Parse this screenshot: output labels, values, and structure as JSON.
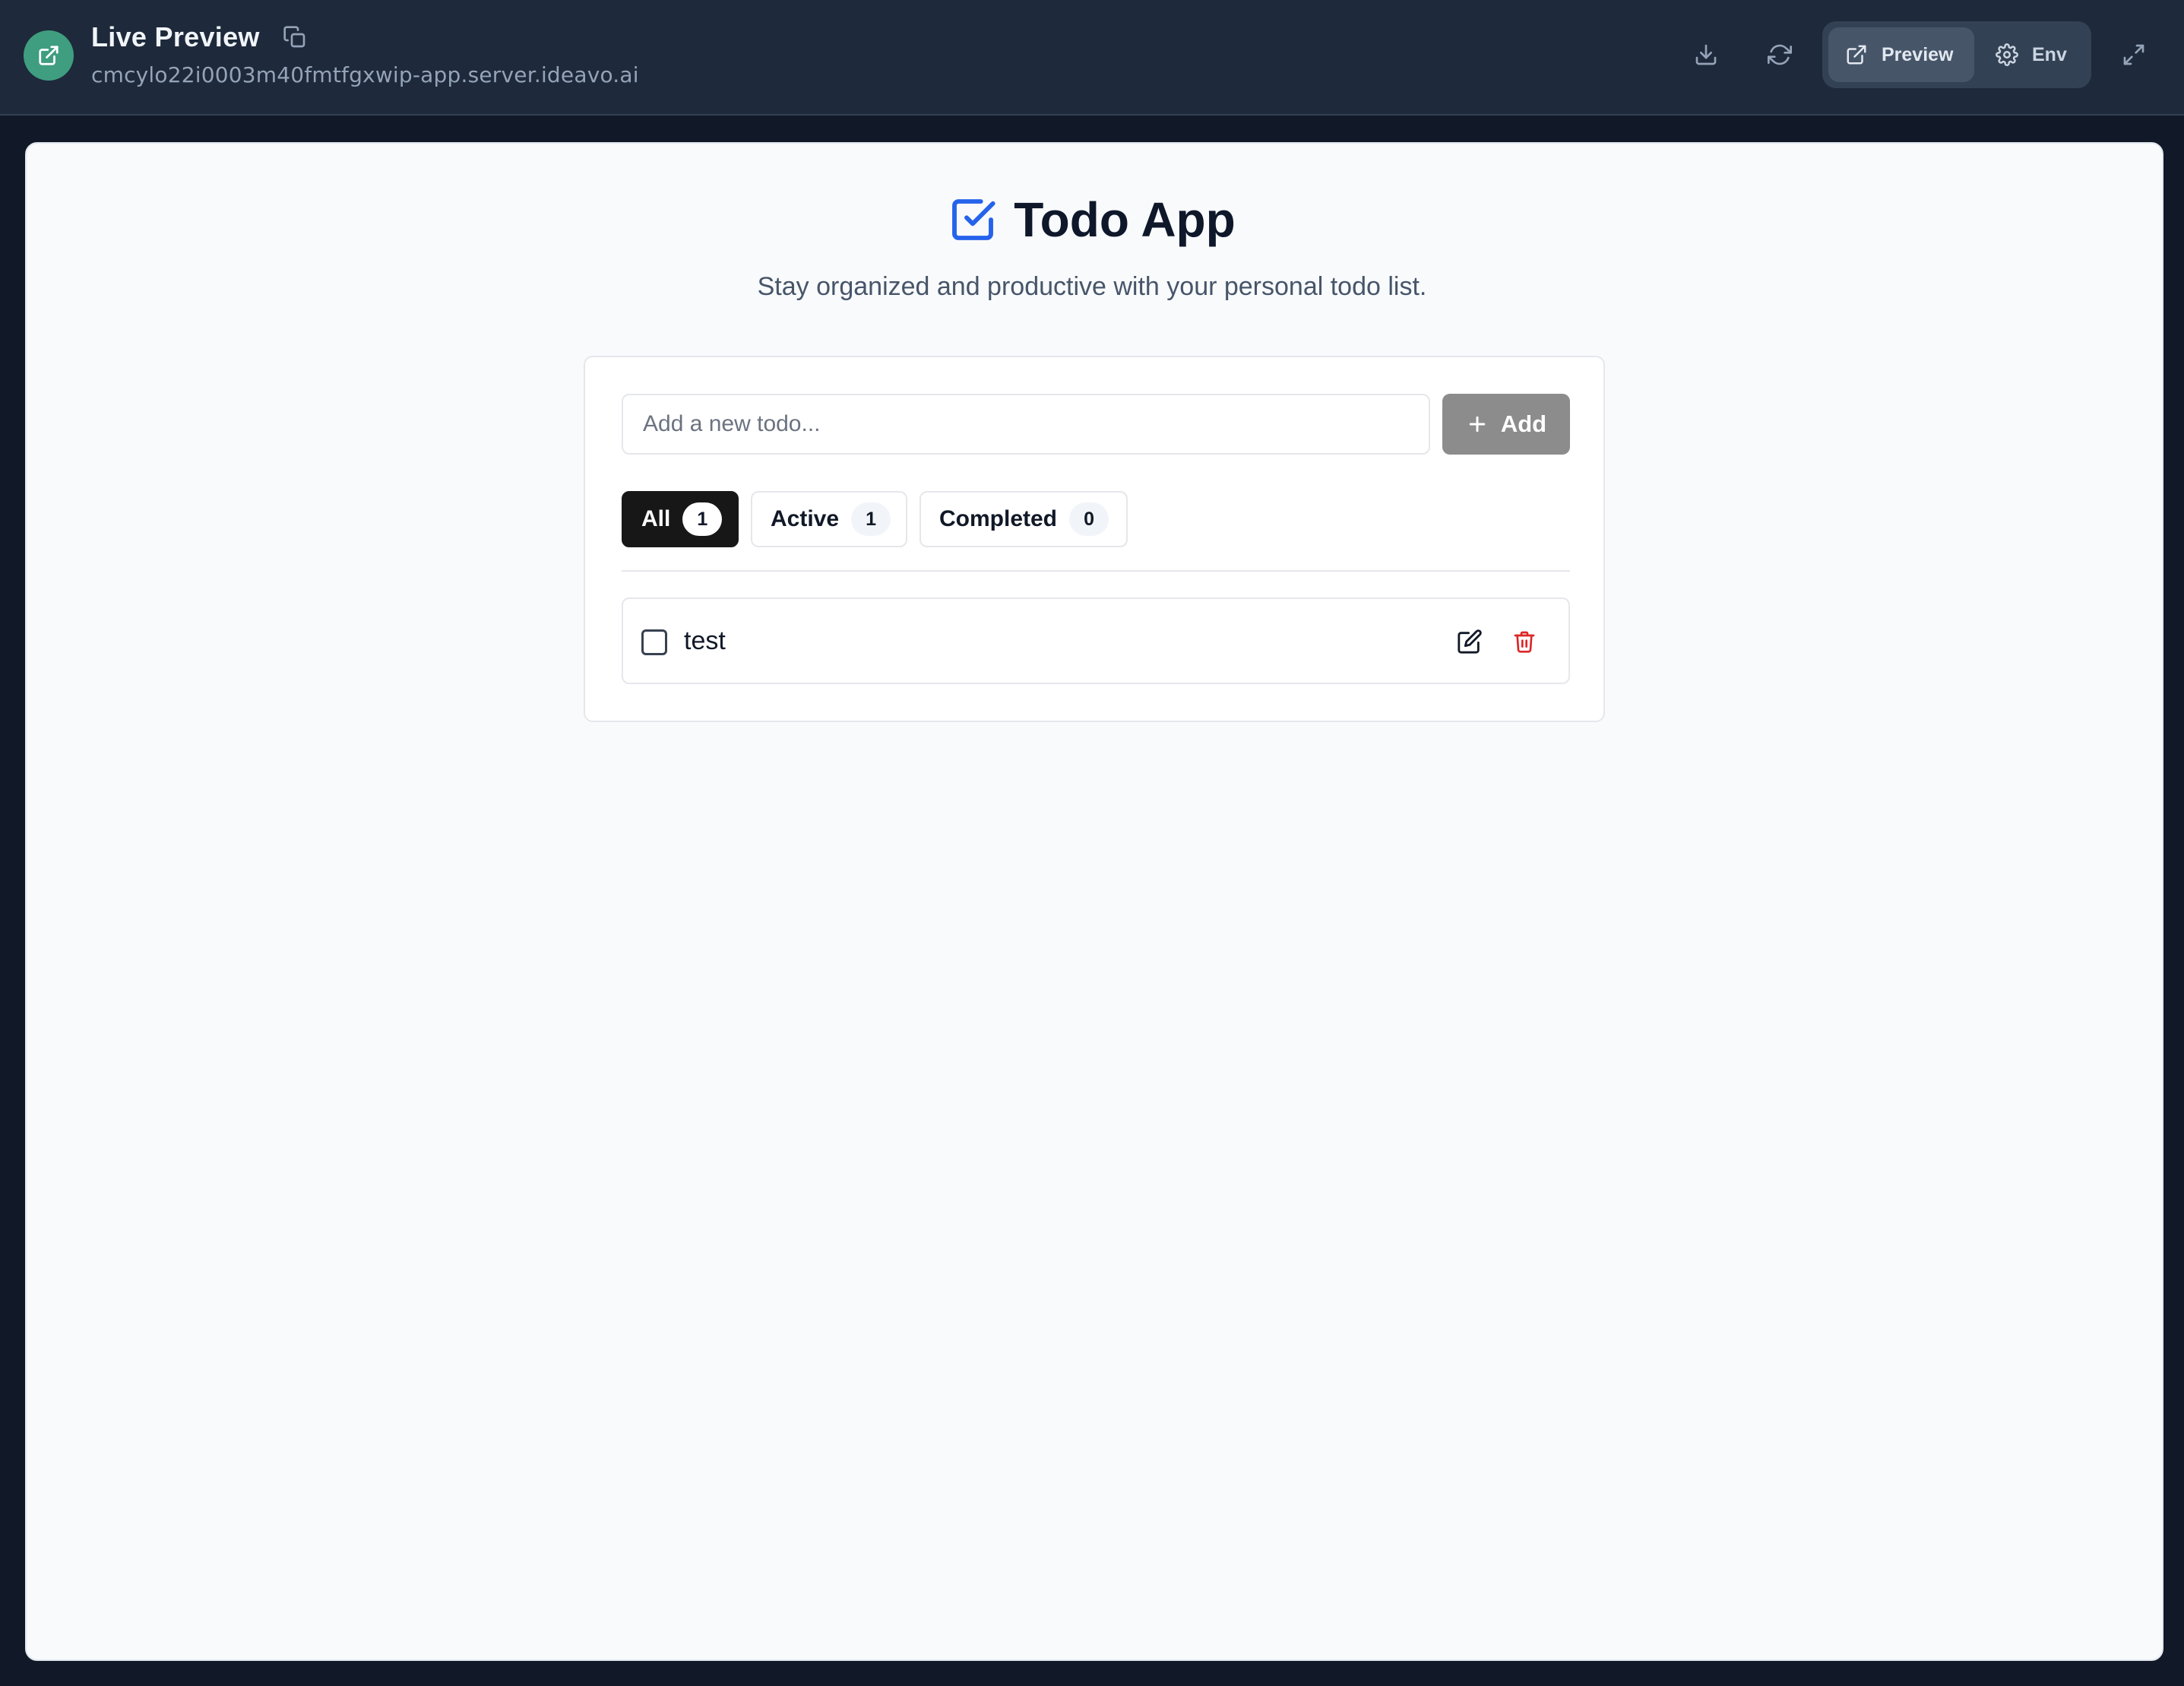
{
  "header": {
    "title": "Live Preview",
    "url": "cmcylo22i0003m40fmtfgxwip-app.server.ideavo.ai",
    "preview_label": "Preview",
    "env_label": "Env",
    "icons": [
      "external-link-icon",
      "copy-icon",
      "download-icon",
      "refresh-icon",
      "gear-icon",
      "expand-icon"
    ]
  },
  "app": {
    "title": "Todo App",
    "subtitle": "Stay organized and productive with your personal todo list.",
    "input_placeholder": "Add a new todo...",
    "input_value": "",
    "add_label": "Add",
    "tabs": [
      {
        "label": "All",
        "count": "1",
        "active": true
      },
      {
        "label": "Active",
        "count": "1",
        "active": false
      },
      {
        "label": "Completed",
        "count": "0",
        "active": false
      }
    ],
    "todos": [
      {
        "text": "test",
        "completed": false
      }
    ]
  },
  "colors": {
    "topbar": "#1e293b",
    "badge": "#3f9e7f",
    "accent_check": "#2563eb",
    "delete": "#dc2626",
    "add_button": "#8c8c8c",
    "active_tab": "#171717"
  }
}
